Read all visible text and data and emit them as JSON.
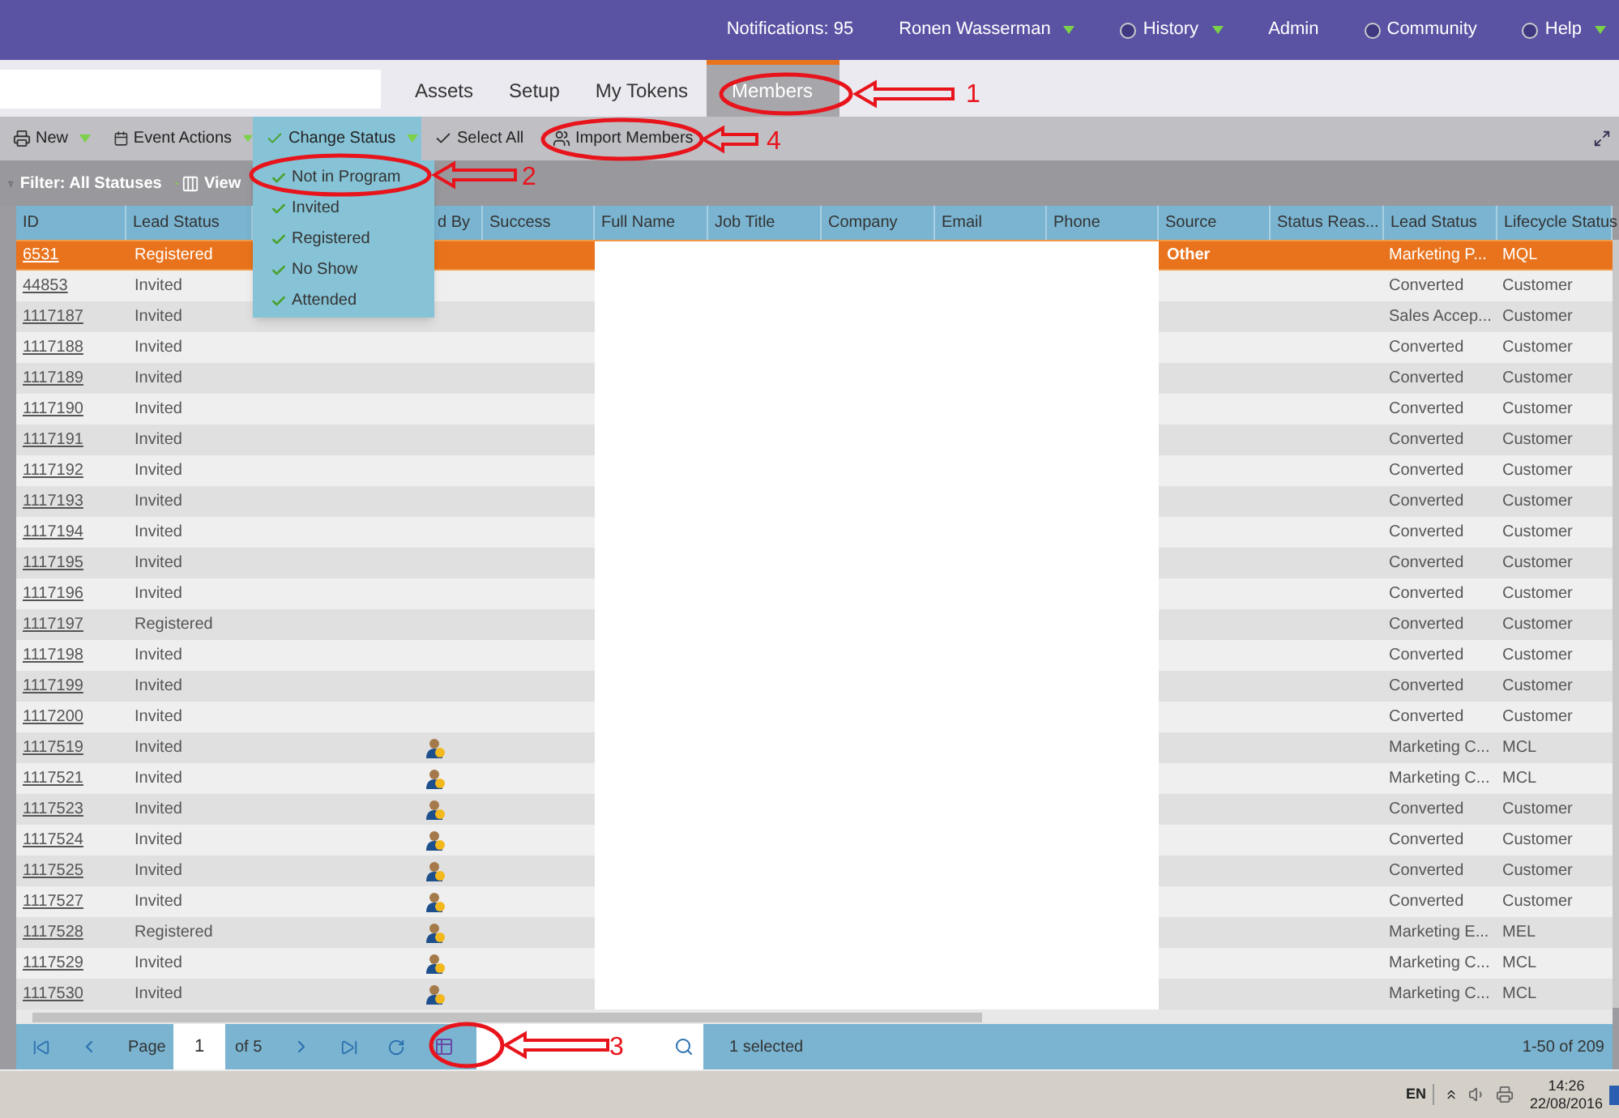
{
  "top_bar": {
    "items": [
      {
        "label": "Notifications: 95",
        "icon": false,
        "caret": false
      },
      {
        "label": "Ronen Wasserman",
        "icon": false,
        "caret": true
      },
      {
        "label": "History",
        "icon": true,
        "caret": true
      },
      {
        "label": "Admin",
        "icon": false,
        "caret": false
      },
      {
        "label": "Community",
        "icon": true,
        "caret": false
      },
      {
        "label": "Help",
        "icon": true,
        "caret": true
      }
    ]
  },
  "tabs": [
    {
      "label": "Assets",
      "selected": false
    },
    {
      "label": "Setup",
      "selected": false
    },
    {
      "label": "My Tokens",
      "selected": false
    },
    {
      "label": "Members",
      "selected": true
    }
  ],
  "toolbar": [
    {
      "label": "New",
      "caret": true,
      "active": false
    },
    {
      "label": "Event Actions",
      "caret": true,
      "active": false
    },
    {
      "label": "Change Status",
      "caret": true,
      "active": true
    },
    {
      "label": "Select All",
      "caret": false,
      "active": false
    },
    {
      "label": "Import Members",
      "caret": false,
      "active": false
    }
  ],
  "filter_bar": {
    "filter": "Filter: All Statuses",
    "view": "View"
  },
  "status_menu": [
    {
      "label": "Not in Program"
    },
    {
      "label": "Invited"
    },
    {
      "label": "Registered"
    },
    {
      "label": "No Show"
    },
    {
      "label": "Attended"
    }
  ],
  "table": {
    "columns": [
      {
        "label": "ID"
      },
      {
        "label": "Lead Status"
      },
      {
        "label": "d By"
      },
      {
        "label": "Success"
      },
      {
        "label": "Full Name"
      },
      {
        "label": "Job Title"
      },
      {
        "label": "Company"
      },
      {
        "label": "Email"
      },
      {
        "label": "Phone"
      },
      {
        "label": "Source"
      },
      {
        "label": "Status Reas..."
      },
      {
        "label": "Lead Status"
      },
      {
        "label": "Lifecycle Status"
      }
    ],
    "rows": [
      {
        "id": "6531",
        "status": "Registered",
        "acquired": false,
        "source": "Other",
        "lead_status": "Marketing P...",
        "lifecycle": "MQL",
        "selected": true
      },
      {
        "id": "44853",
        "status": "Invited",
        "acquired": false,
        "lead_status": "Converted",
        "lifecycle": "Customer",
        "selected": false
      },
      {
        "id": "1117187",
        "status": "Invited",
        "acquired": false,
        "lead_status": "Sales Accep...",
        "lifecycle": "Customer",
        "selected": false
      },
      {
        "id": "1117188",
        "status": "Invited",
        "acquired": false,
        "lead_status": "Converted",
        "lifecycle": "Customer",
        "selected": false
      },
      {
        "id": "1117189",
        "status": "Invited",
        "acquired": false,
        "lead_status": "Converted",
        "lifecycle": "Customer",
        "selected": false
      },
      {
        "id": "1117190",
        "status": "Invited",
        "acquired": false,
        "lead_status": "Converted",
        "lifecycle": "Customer",
        "selected": false
      },
      {
        "id": "1117191",
        "status": "Invited",
        "acquired": false,
        "lead_status": "Converted",
        "lifecycle": "Customer",
        "selected": false
      },
      {
        "id": "1117192",
        "status": "Invited",
        "acquired": false,
        "lead_status": "Converted",
        "lifecycle": "Customer",
        "selected": false
      },
      {
        "id": "1117193",
        "status": "Invited",
        "acquired": false,
        "lead_status": "Converted",
        "lifecycle": "Customer",
        "selected": false
      },
      {
        "id": "1117194",
        "status": "Invited",
        "acquired": false,
        "lead_status": "Converted",
        "lifecycle": "Customer",
        "selected": false
      },
      {
        "id": "1117195",
        "status": "Invited",
        "acquired": false,
        "lead_status": "Converted",
        "lifecycle": "Customer",
        "selected": false
      },
      {
        "id": "1117196",
        "status": "Invited",
        "acquired": false,
        "lead_status": "Converted",
        "lifecycle": "Customer",
        "selected": false
      },
      {
        "id": "1117197",
        "status": "Registered",
        "acquired": false,
        "lead_status": "Converted",
        "lifecycle": "Customer",
        "selected": false
      },
      {
        "id": "1117198",
        "status": "Invited",
        "acquired": false,
        "lead_status": "Converted",
        "lifecycle": "Customer",
        "selected": false
      },
      {
        "id": "1117199",
        "status": "Invited",
        "acquired": false,
        "lead_status": "Converted",
        "lifecycle": "Customer",
        "selected": false
      },
      {
        "id": "1117200",
        "status": "Invited",
        "acquired": false,
        "lead_status": "Converted",
        "lifecycle": "Customer",
        "selected": false
      },
      {
        "id": "1117519",
        "status": "Invited",
        "acquired": true,
        "lead_status": "Marketing C...",
        "lifecycle": "MCL",
        "selected": false
      },
      {
        "id": "1117521",
        "status": "Invited",
        "acquired": true,
        "lead_status": "Marketing C...",
        "lifecycle": "MCL",
        "selected": false
      },
      {
        "id": "1117523",
        "status": "Invited",
        "acquired": true,
        "lead_status": "Converted",
        "lifecycle": "Customer",
        "selected": false
      },
      {
        "id": "1117524",
        "status": "Invited",
        "acquired": true,
        "lead_status": "Converted",
        "lifecycle": "Customer",
        "selected": false
      },
      {
        "id": "1117525",
        "status": "Invited",
        "acquired": true,
        "lead_status": "Converted",
        "lifecycle": "Customer",
        "selected": false
      },
      {
        "id": "1117527",
        "status": "Invited",
        "acquired": true,
        "lead_status": "Converted",
        "lifecycle": "Customer",
        "selected": false
      },
      {
        "id": "1117528",
        "status": "Registered",
        "acquired": true,
        "lead_status": "Marketing E...",
        "lifecycle": "MEL",
        "selected": false
      },
      {
        "id": "1117529",
        "status": "Invited",
        "acquired": true,
        "lead_status": "Marketing C...",
        "lifecycle": "MCL",
        "selected": false
      },
      {
        "id": "1117530",
        "status": "Invited",
        "acquired": true,
        "lead_status": "Marketing C...",
        "lifecycle": "MCL",
        "selected": false
      }
    ]
  },
  "pager": {
    "page_label": "Page",
    "page": "1",
    "of": "of 5",
    "selected": "1 selected",
    "range": "1-50 of 209"
  },
  "taskbar": {
    "language": "EN",
    "time": "14:26",
    "date": "22/08/2016"
  },
  "annotations": [
    {
      "label": "1"
    },
    {
      "label": "2"
    },
    {
      "label": "3"
    },
    {
      "label": "4"
    }
  ]
}
